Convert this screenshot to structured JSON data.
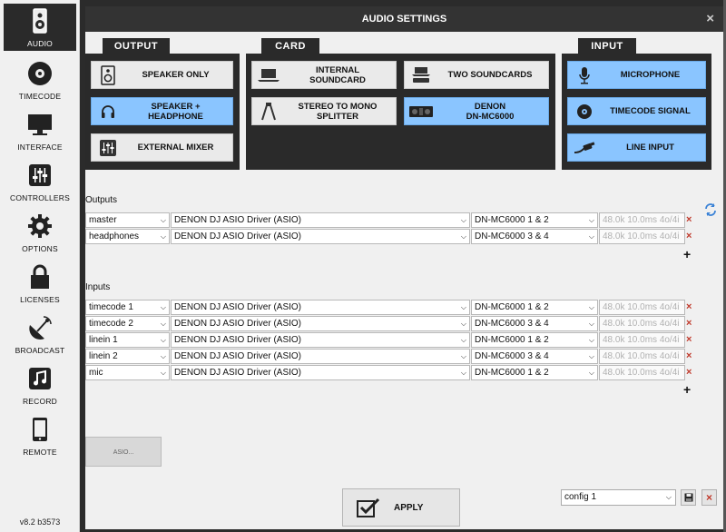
{
  "sidebar": {
    "items": [
      {
        "label": "AUDIO",
        "icon": "speaker-icon"
      },
      {
        "label": "TIMECODE",
        "icon": "vinyl-icon"
      },
      {
        "label": "INTERFACE",
        "icon": "monitor-icon"
      },
      {
        "label": "CONTROLLERS",
        "icon": "sliders-icon"
      },
      {
        "label": "OPTIONS",
        "icon": "gear-icon"
      },
      {
        "label": "LICENSES",
        "icon": "lock-icon"
      },
      {
        "label": "BROADCAST",
        "icon": "satellite-icon"
      },
      {
        "label": "RECORD",
        "icon": "music-note-icon"
      },
      {
        "label": "REMOTE",
        "icon": "phone-icon"
      }
    ],
    "version": "v8.2 b3573"
  },
  "dialog": {
    "title": "AUDIO SETTINGS",
    "close": "×"
  },
  "output": {
    "tab": "OUTPUT",
    "buttons": [
      {
        "label_line1": "SPEAKER ONLY",
        "label_line2": "",
        "selected": false
      },
      {
        "label_line1": "SPEAKER +",
        "label_line2": "HEADPHONE",
        "selected": true
      },
      {
        "label_line1": "EXTERNAL MIXER",
        "label_line2": "",
        "selected": false
      }
    ]
  },
  "card": {
    "tab": "CARD",
    "buttons": [
      {
        "label_line1": "INTERNAL",
        "label_line2": "SOUNDCARD",
        "selected": false
      },
      {
        "label_line1": "TWO SOUNDCARDS",
        "label_line2": "",
        "selected": false
      },
      {
        "label_line1": "STEREO TO MONO",
        "label_line2": "SPLITTER",
        "selected": false
      },
      {
        "label_line1": "DENON",
        "label_line2": "DN-MC6000",
        "selected": true
      }
    ]
  },
  "input": {
    "tab": "INPUT",
    "buttons": [
      {
        "label_line1": "MICROPHONE",
        "label_line2": "",
        "selected": true
      },
      {
        "label_line1": "TIMECODE SIGNAL",
        "label_line2": "",
        "selected": true
      },
      {
        "label_line1": "LINE INPUT",
        "label_line2": "",
        "selected": true
      }
    ]
  },
  "outputs": {
    "label": "Outputs",
    "rows": [
      {
        "name": "master",
        "driver": "DENON DJ ASIO Driver (ASIO)",
        "channel": "DN-MC6000 1 & 2",
        "info": "48.0k 10.0ms 4o/4i"
      },
      {
        "name": "headphones",
        "driver": "DENON DJ ASIO Driver (ASIO)",
        "channel": "DN-MC6000 3 & 4",
        "info": "48.0k 10.0ms 4o/4i"
      }
    ]
  },
  "inputs": {
    "label": "Inputs",
    "rows": [
      {
        "name": "timecode 1",
        "driver": "DENON DJ ASIO Driver (ASIO)",
        "channel": "DN-MC6000 1 & 2",
        "info": "48.0k 10.0ms 4o/4i"
      },
      {
        "name": "timecode 2",
        "driver": "DENON DJ ASIO Driver (ASIO)",
        "channel": "DN-MC6000 3 & 4",
        "info": "48.0k 10.0ms 4o/4i"
      },
      {
        "name": "linein 1",
        "driver": "DENON DJ ASIO Driver (ASIO)",
        "channel": "DN-MC6000 1 & 2",
        "info": "48.0k 10.0ms 4o/4i"
      },
      {
        "name": "linein 2",
        "driver": "DENON DJ ASIO Driver (ASIO)",
        "channel": "DN-MC6000 3 & 4",
        "info": "48.0k 10.0ms 4o/4i"
      },
      {
        "name": "mic",
        "driver": "DENON DJ ASIO Driver (ASIO)",
        "channel": "DN-MC6000 1 & 2",
        "info": "48.0k 10.0ms 4o/4i"
      }
    ]
  },
  "asio_button": "ASIO...",
  "apply_button": "APPLY",
  "config": {
    "value": "config 1"
  },
  "colors": {
    "selected": "#8ac5ff",
    "dark": "#2a2a2a",
    "delete": "#c0392b"
  }
}
